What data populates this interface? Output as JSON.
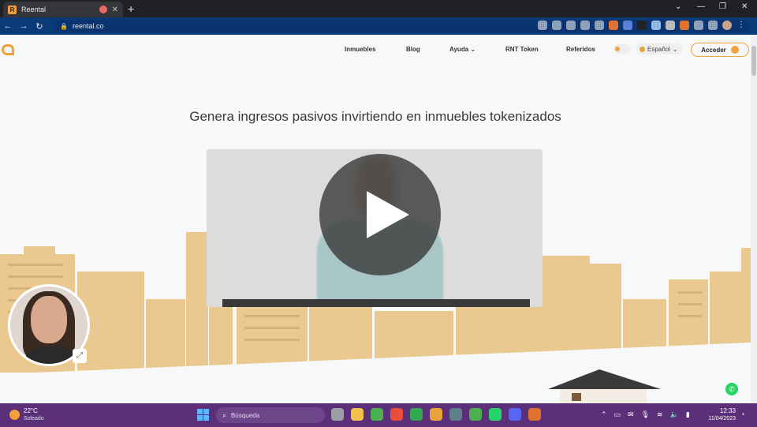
{
  "browser": {
    "tab_title": "Reental",
    "tab_favicon_letter": "R",
    "url": "reental.co",
    "new_tab": "+",
    "tab_close": "✕",
    "window_controls": [
      "⌄",
      "—",
      "❐",
      "✕"
    ]
  },
  "site": {
    "nav": [
      "Inmuebles",
      "Blog",
      "Ayuda ⌄",
      "RNT Token",
      "Referidos"
    ],
    "language": "Español",
    "login_label": "Acceder",
    "headline": "Genera ingresos pasivos invirtiendo en inmuebles tokenizados",
    "accent_color": "#f2a03d"
  },
  "taskbar": {
    "weather_temp": "22°C",
    "weather_desc": "Soleado",
    "search_placeholder": "Búsqueda",
    "time": "12:33",
    "date": "11/04/2023"
  }
}
